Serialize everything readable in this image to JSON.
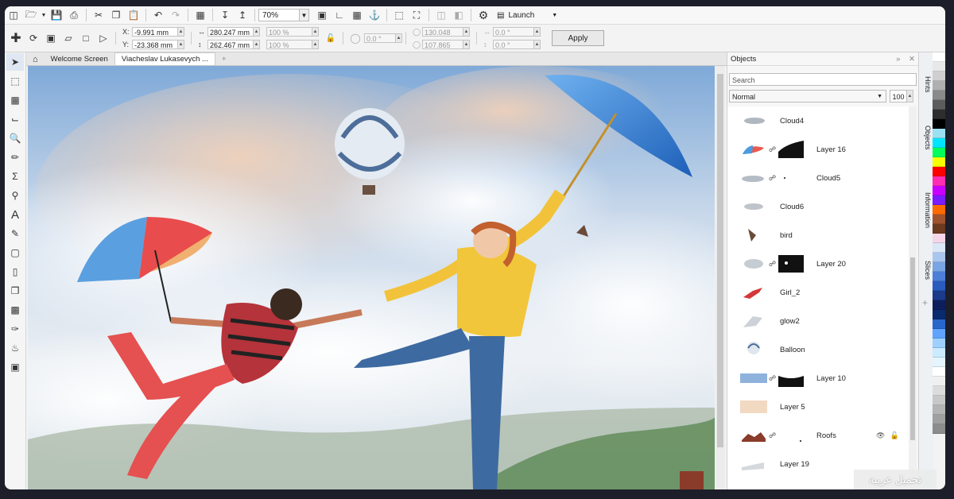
{
  "toolbar": {
    "zoom": "70%",
    "launch_label": "Launch"
  },
  "property_bar": {
    "x_label": "X:",
    "y_label": "Y:",
    "x_value": "-9.991 mm",
    "y_value": "-23.368 mm",
    "width_value": "280.247 mm",
    "height_value": "262.467 mm",
    "scale_x": "100 %",
    "scale_y": "100 %",
    "rotation": "0.0 °",
    "center_x": "130.048 mm",
    "center_y": "107.865 mm",
    "skew_h": "0.0 °",
    "skew_v": "0.0 °",
    "apply_label": "Apply"
  },
  "tabs": [
    {
      "label": "Welcome Screen"
    },
    {
      "label": "Viacheslav Lukasevych ..."
    }
  ],
  "objects_panel": {
    "title": "Objects",
    "search_placeholder": "Search",
    "blend_mode": "Normal",
    "opacity": "100",
    "layers": [
      {
        "name": "Cloud4"
      },
      {
        "name": "Layer 16"
      },
      {
        "name": "Cloud5"
      },
      {
        "name": "Cloud6"
      },
      {
        "name": "bird"
      },
      {
        "name": "Layer 20"
      },
      {
        "name": "Girl_2"
      },
      {
        "name": "glow2"
      },
      {
        "name": "Balloon"
      },
      {
        "name": "Layer 10"
      },
      {
        "name": "Layer 5"
      },
      {
        "name": "Roofs"
      },
      {
        "name": "Layer 19"
      }
    ]
  },
  "side_tabs": {
    "hints": "Hints",
    "objects": "Objects",
    "information": "Information",
    "slices": "Slices"
  },
  "palette": [
    "#ffffff",
    "#e8e8e8",
    "#cfcfcf",
    "#b0b0b0",
    "#8a8a8a",
    "#5c5c5c",
    "#2e2e2e",
    "#000000",
    "#9be1f2",
    "#00e5ff",
    "#00ff5a",
    "#f5ff00",
    "#ff0000",
    "#ff2db3",
    "#c800ff",
    "#7a1cff",
    "#ff6a00",
    "#a0522d",
    "#6b3a1f",
    "#f5d6e8",
    "#dbe7f7",
    "#a9c6ee",
    "#7aa5e4",
    "#4d7fd8",
    "#2a5bbf",
    "#1b3a8a",
    "#0c1f5c",
    "#0a2a6e",
    "#2966c9",
    "#5fa3ff",
    "#9ed0ff",
    "#ccebff",
    "#e5f5ff",
    "#ffffff",
    "#f0f0f0",
    "#dcdcdc",
    "#c8c8c8",
    "#b4b4b4",
    "#a0a0a0",
    "#8c8c8c"
  ],
  "watermark": "تحميل عربية"
}
